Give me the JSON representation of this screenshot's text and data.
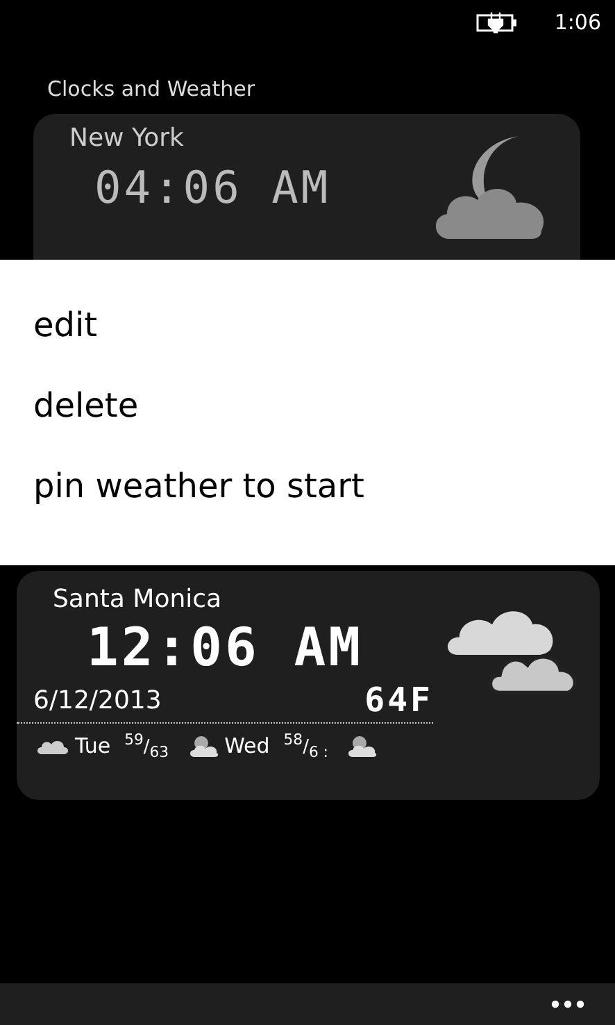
{
  "status_bar": {
    "time": "1:06"
  },
  "title": "Clocks and Weather",
  "cities": [
    {
      "name": "New York",
      "time": "04:06 AM",
      "kind": "night"
    },
    {
      "name": "Santa Monica",
      "time": "12:06 AM",
      "kind": "cloudy",
      "date": "6/12/2013",
      "temp": "64F",
      "forecast": [
        {
          "kind": "cloudy",
          "day": "Tue",
          "temps": "$^{59}$/$_{63}$"
        },
        {
          "kind": "partly",
          "day": "Wed",
          "temps": "$^{58}$/$_{6 :}$"
        },
        {
          "kind": "partly"
        }
      ]
    }
  ],
  "context_menu": {
    "items": [
      "edit",
      "delete",
      "pin weather to start"
    ]
  }
}
